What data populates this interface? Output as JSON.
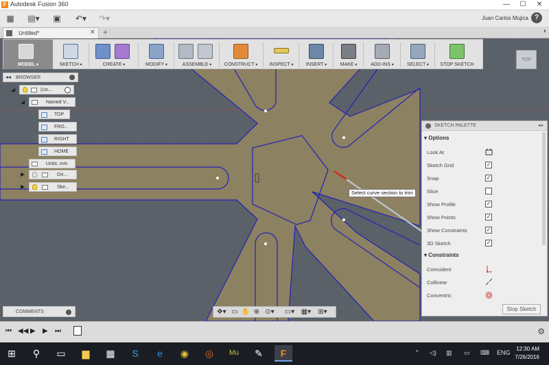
{
  "window": {
    "title": "Autodesk Fusion 360",
    "min": "—",
    "max": "☐",
    "close": "✕"
  },
  "quickaccess": {
    "user": "Juan Carlos Mujica",
    "help": "?"
  },
  "tabs": {
    "document": "Untitled*",
    "new_tab": "+"
  },
  "toolbar": {
    "model": "MODEL",
    "sketch": "SKETCH",
    "create": "CREATE",
    "modify": "MODIFY",
    "assemble": "ASSEMBLE",
    "construct": "CONSTRUCT",
    "inspect": "INSPECT",
    "insert": "INSERT",
    "make": "MAKE",
    "addins": "ADD-INS",
    "select": "SELECT",
    "stop_sketch": "STOP SKETCH"
  },
  "viewcube": "TOP",
  "browser": {
    "title": "BROWSER",
    "root": "(Un...",
    "named_views": "Named V...",
    "views": [
      "TOP",
      "FRO...",
      "RIGHT",
      "HOME"
    ],
    "units": "Units: mm",
    "origin": "Ori...",
    "sketches": "Ske..."
  },
  "comments": "COMMENTS",
  "tooltip": "Select curve section to trim",
  "palette": {
    "title": "SKETCH PALETTE",
    "options_header": "Options",
    "options": [
      {
        "label": "Look At",
        "checked": null,
        "icon": "look-at-icon"
      },
      {
        "label": "Sketch Grid",
        "checked": true
      },
      {
        "label": "Snap",
        "checked": true
      },
      {
        "label": "Slice",
        "checked": false
      },
      {
        "label": "Show Profile",
        "checked": true
      },
      {
        "label": "Show Points",
        "checked": true
      },
      {
        "label": "Show Constraints",
        "checked": true
      },
      {
        "label": "3D Sketch",
        "checked": true
      }
    ],
    "constraints_header": "Constraints",
    "constraints": [
      {
        "label": "Coincident",
        "icon": "coincident-icon"
      },
      {
        "label": "Collinear",
        "icon": "collinear-icon"
      },
      {
        "label": "Concentric",
        "icon": "concentric-icon"
      }
    ],
    "stop_button": "Stop Sketch"
  },
  "taskbar": {
    "language": "ENG",
    "time": "12:30 AM",
    "date": "7/26/2016"
  },
  "colors": {
    "sketch_fill": "#8c8161",
    "sketch_line": "#2420b8",
    "trim_highlight": "#e11a1a",
    "canvas": "#5b6168"
  }
}
